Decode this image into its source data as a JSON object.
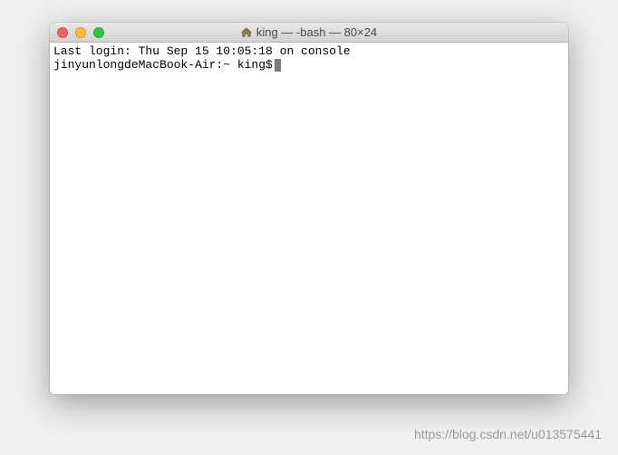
{
  "titlebar": {
    "title": "king — -bash — 80×24",
    "icon": "home-icon"
  },
  "terminal": {
    "last_login": "Last login: Thu Sep 15 10:05:18 on console",
    "prompt": "jinyunlongdeMacBook-Air:~ king$ "
  },
  "watermark": "https://blog.csdn.net/u013575441"
}
